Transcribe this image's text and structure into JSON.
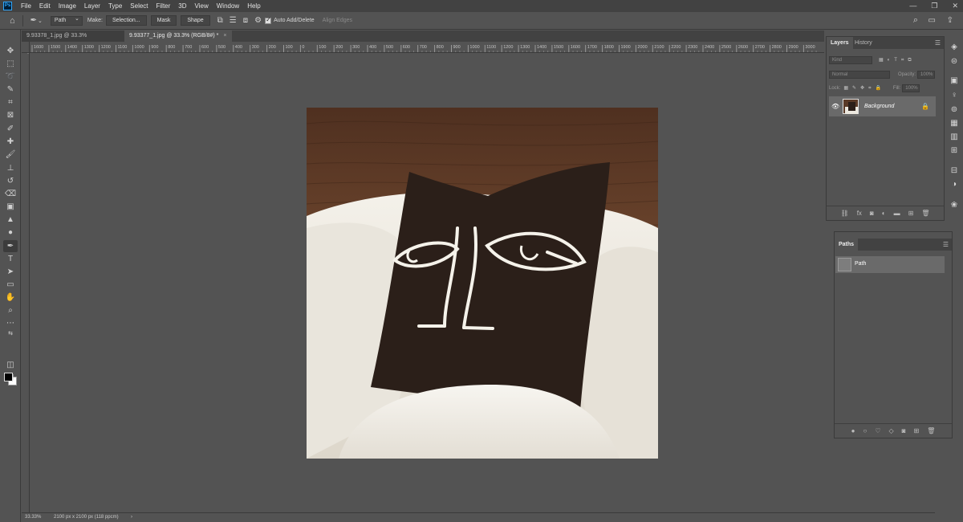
{
  "menubar": {
    "app_icon": "Ps",
    "items": [
      "File",
      "Edit",
      "Image",
      "Layer",
      "Type",
      "Select",
      "Filter",
      "3D",
      "View",
      "Window",
      "Help"
    ],
    "window_controls": [
      "—",
      "❐",
      "✕"
    ]
  },
  "options": {
    "tool_mode_value": "Path",
    "make_label": "Make:",
    "selection_btn": "Selection...",
    "mask_btn": "Mask",
    "shape_btn": "Shape",
    "auto_add_delete": "Auto Add/Delete",
    "auto_add_delete_checked": true,
    "align_edges": "Align Edges"
  },
  "tabs": [
    {
      "label": "9.93378_1.jpg @ 33.3% (RGB/8#)",
      "close": "×",
      "active": false
    },
    {
      "label": "9.93377_1.jpg @ 33.3% (RGB/8#) *",
      "close": "×",
      "active": true
    }
  ],
  "ruler": {
    "labels": [
      "1600",
      "1500",
      "1400",
      "1300",
      "1200",
      "1100",
      "1000",
      "900",
      "800",
      "700",
      "600",
      "500",
      "400",
      "300",
      "200",
      "100",
      "0",
      "100",
      "200",
      "300",
      "400",
      "500",
      "600",
      "700",
      "800",
      "900",
      "1000",
      "1100",
      "1200",
      "1300",
      "1400",
      "1500",
      "1600",
      "1700",
      "1800",
      "1900",
      "2000",
      "2100",
      "2200",
      "2300",
      "2400",
      "2500",
      "2600",
      "2700",
      "2800",
      "2900",
      "3000"
    ]
  },
  "tools": [
    "move-icon",
    "marquee-icon",
    "lasso-icon",
    "quick-select-icon",
    "crop-icon",
    "frame-icon",
    "eyedropper-icon",
    "healing-icon",
    "brush-icon",
    "stamp-icon",
    "history-brush-icon",
    "eraser-icon",
    "gradient-icon",
    "blur-icon",
    "dodge-icon",
    "pen-icon",
    "type-icon",
    "path-select-icon",
    "rectangle-icon",
    "hand-icon",
    "zoom-icon",
    "more-icon"
  ],
  "layers_panel": {
    "tabs": [
      "Layers",
      "History"
    ],
    "kind_placeholder": "Kind",
    "blend_mode": "Normal",
    "opacity_label": "Opacity:",
    "opacity_value": "100%",
    "lock_label": "Lock:",
    "fill_label": "Fill:",
    "fill_value": "100%",
    "layer_name": "Background"
  },
  "paths_panel": {
    "tab": "Paths",
    "path_name": "Path"
  },
  "status": {
    "zoom": "33.33%",
    "doc_size": "2100 px x 2100 px (118 ppcm)",
    "arrow": "›"
  },
  "colors": {
    "ui_bg": "#535353",
    "ui_dark": "#424242",
    "pillow": "#2a1e18",
    "wood": "#6e4a32",
    "chair": "#ece8df"
  }
}
